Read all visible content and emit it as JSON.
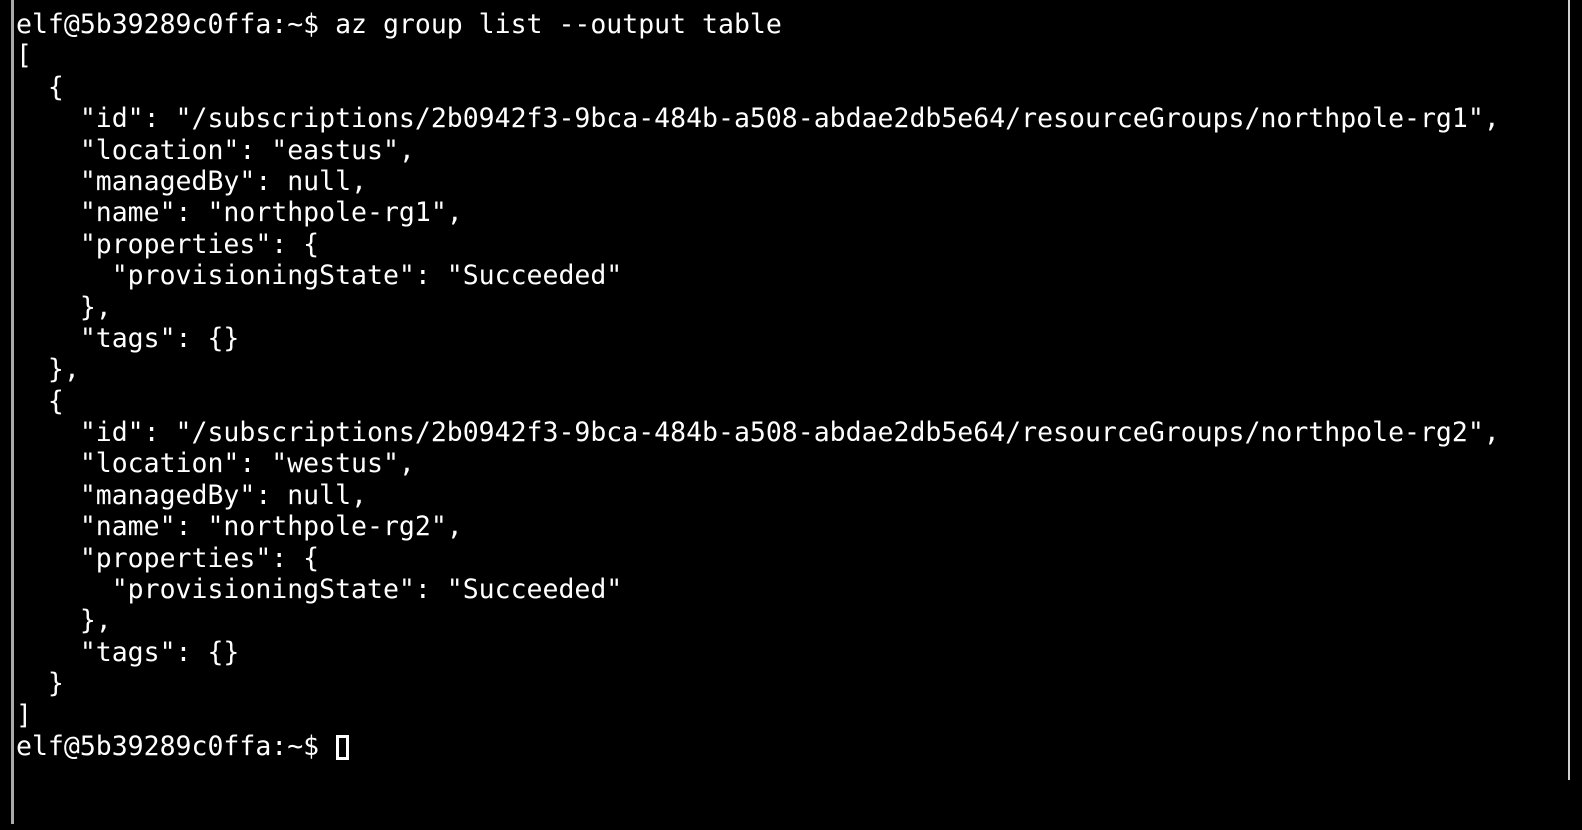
{
  "terminal": {
    "title": "terminal",
    "background_color": "#000000",
    "foreground_color": "#ffffff",
    "edge_rule_color": "#a9a9a9",
    "cursor": {
      "style": "hollow-block",
      "color": "#ffffff"
    },
    "prompt": "elf@5b39289c0ffa:~$",
    "user": "elf",
    "host": "5b39289c0ffa",
    "cwd": "~",
    "command": "az group list --output table",
    "lines": [
      "elf@5b39289c0ffa:~$ az group list --output table",
      "[",
      "  {",
      "    \"id\": \"/subscriptions/2b0942f3-9bca-484b-a508-abdae2db5e64/resourceGroups/northpole-rg1\",",
      "    \"location\": \"eastus\",",
      "    \"managedBy\": null,",
      "    \"name\": \"northpole-rg1\",",
      "    \"properties\": {",
      "      \"provisioningState\": \"Succeeded\"",
      "    },",
      "    \"tags\": {}",
      "  },",
      "  {",
      "    \"id\": \"/subscriptions/2b0942f3-9bca-484b-a508-abdae2db5e64/resourceGroups/northpole-rg2\",",
      "    \"location\": \"westus\",",
      "    \"managedBy\": null,",
      "    \"name\": \"northpole-rg2\",",
      "    \"properties\": {",
      "      \"provisioningState\": \"Succeeded\"",
      "    },",
      "    \"tags\": {}",
      "  }",
      "]"
    ],
    "final_prompt": "elf@5b39289c0ffa:~$ ",
    "resource_groups": [
      {
        "id": "/subscriptions/2b0942f3-9bca-484b-a508-abdae2db5e64/resourceGroups/northpole-rg1",
        "location": "eastus",
        "managedBy": "null",
        "name": "northpole-rg1",
        "provisioningState": "Succeeded",
        "tags": "{}"
      },
      {
        "id": "/subscriptions/2b0942f3-9bca-484b-a508-abdae2db5e64/resourceGroups/northpole-rg2",
        "location": "westus",
        "managedBy": "null",
        "name": "northpole-rg2",
        "provisioningState": "Succeeded",
        "tags": "{}"
      }
    ],
    "subscription_id": "2b0942f3-9bca-484b-a508-abdae2db5e64"
  }
}
